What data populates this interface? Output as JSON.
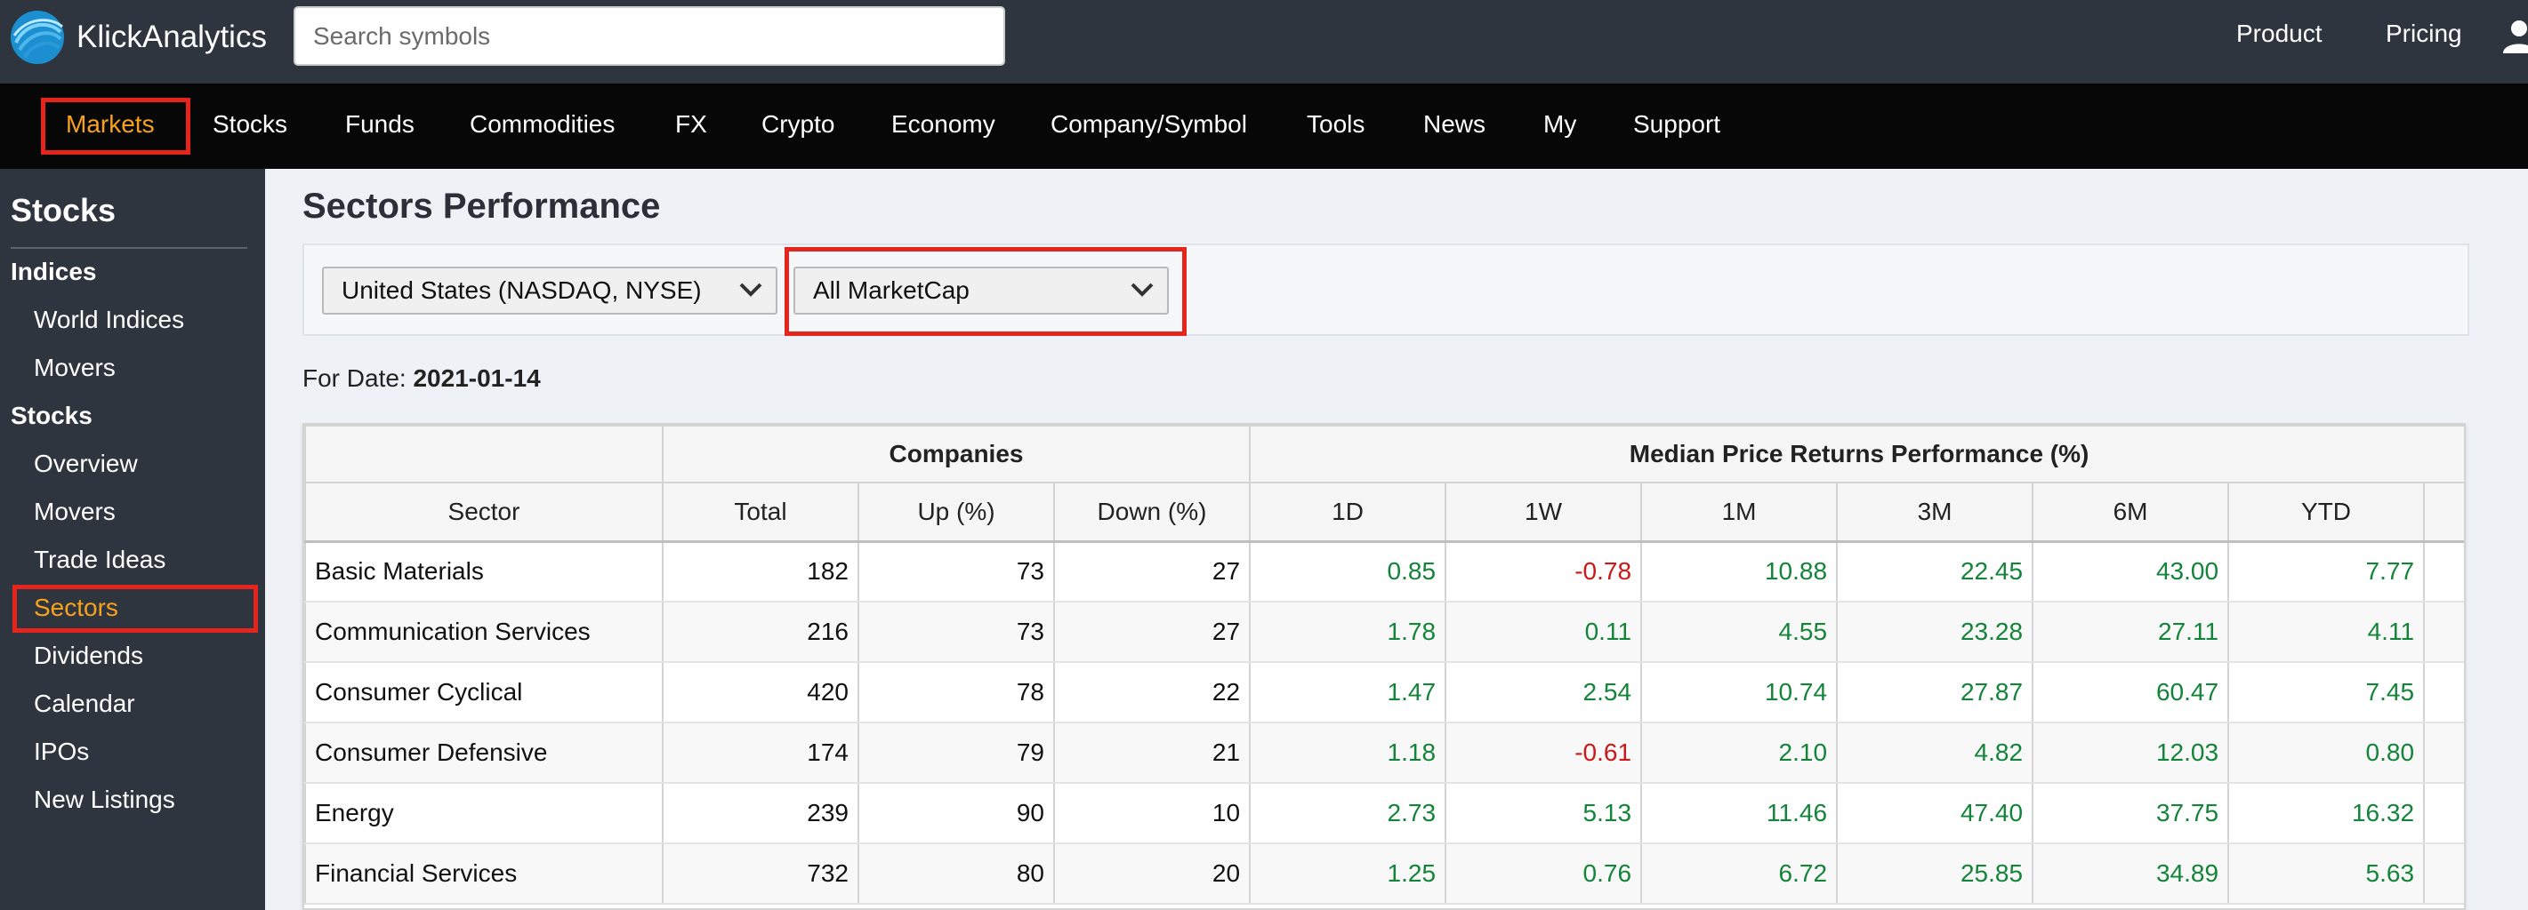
{
  "header": {
    "brand": "KlickAnalytics",
    "search_placeholder": "Search symbols",
    "links": [
      "Product",
      "Pricing"
    ]
  },
  "mainnav": {
    "items": [
      "Markets",
      "Stocks",
      "Funds",
      "Commodities",
      "FX",
      "Crypto",
      "Economy",
      "Company/Symbol",
      "Tools",
      "News",
      "My",
      "Support"
    ],
    "active": "Markets"
  },
  "sidebar": {
    "title": "Stocks",
    "section_indices": "Indices",
    "indices_items": [
      "World Indices",
      "Movers"
    ],
    "section_stocks": "Stocks",
    "stocks_items": [
      "Overview",
      "Movers",
      "Trade Ideas",
      "Sectors",
      "Dividends",
      "Calendar",
      "IPOs",
      "New Listings"
    ],
    "active": "Sectors"
  },
  "page": {
    "title": "Sectors Performance",
    "country_select": "United States (NASDAQ, NYSE)",
    "marketcap_select": "All MarketCap",
    "for_date_label": "For Date:",
    "for_date_value": "2021-01-14"
  },
  "table": {
    "group_companies": "Companies",
    "group_returns": "Median Price Returns Performance (%)",
    "columns": [
      "Sector",
      "Total",
      "Up (%)",
      "Down (%)",
      "1D",
      "1W",
      "1M",
      "3M",
      "6M",
      "YTD"
    ],
    "rows": [
      {
        "sector": "Basic Materials",
        "total": "182",
        "up": "73",
        "down": "27",
        "d1": "0.85",
        "w1": "-0.78",
        "m1": "10.88",
        "m3": "22.45",
        "m6": "43.00",
        "ytd": "7.77"
      },
      {
        "sector": "Communication Services",
        "total": "216",
        "up": "73",
        "down": "27",
        "d1": "1.78",
        "w1": "0.11",
        "m1": "4.55",
        "m3": "23.28",
        "m6": "27.11",
        "ytd": "4.11"
      },
      {
        "sector": "Consumer Cyclical",
        "total": "420",
        "up": "78",
        "down": "22",
        "d1": "1.47",
        "w1": "2.54",
        "m1": "10.74",
        "m3": "27.87",
        "m6": "60.47",
        "ytd": "7.45"
      },
      {
        "sector": "Consumer Defensive",
        "total": "174",
        "up": "79",
        "down": "21",
        "d1": "1.18",
        "w1": "-0.61",
        "m1": "2.10",
        "m3": "4.82",
        "m6": "12.03",
        "ytd": "0.80"
      },
      {
        "sector": "Energy",
        "total": "239",
        "up": "90",
        "down": "10",
        "d1": "2.73",
        "w1": "5.13",
        "m1": "11.46",
        "m3": "47.40",
        "m6": "37.75",
        "ytd": "16.32"
      },
      {
        "sector": "Financial Services",
        "total": "732",
        "up": "80",
        "down": "20",
        "d1": "1.25",
        "w1": "0.76",
        "m1": "6.72",
        "m3": "25.85",
        "m6": "34.89",
        "ytd": "5.63"
      }
    ]
  },
  "colors": {
    "accent": "#f7a21b",
    "highlight": "#e5251d",
    "positive": "#13843a",
    "negative": "#cc1818"
  }
}
